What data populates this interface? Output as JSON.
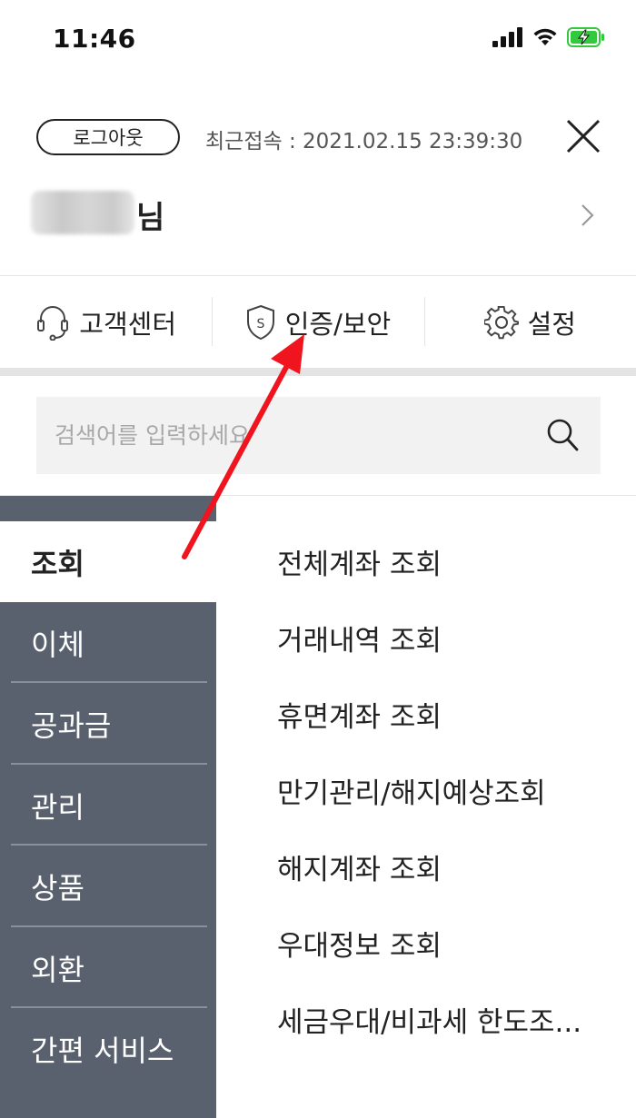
{
  "status_bar": {
    "time": "11:46",
    "icons": [
      "cellular-signal-icon",
      "wifi-icon",
      "battery-charging-icon"
    ]
  },
  "header": {
    "logout_label": "로그아웃",
    "last_login": "최근접속 : 2021.02.15 23:39:30",
    "close_icon": "close-icon",
    "user_suffix": "님",
    "user_chevron_icon": "chevron-right-icon"
  },
  "quick_menu": [
    {
      "label": "고객센터",
      "icon": "headset-icon"
    },
    {
      "label": "인증/보안",
      "icon": "shield-icon"
    },
    {
      "label": "설정",
      "icon": "gear-icon"
    }
  ],
  "search": {
    "placeholder": "검색어를 입력하세요",
    "value": "",
    "icon": "search-icon"
  },
  "categories": [
    {
      "label": "조회",
      "selected": true
    },
    {
      "label": "이체",
      "selected": false
    },
    {
      "label": "공과금",
      "selected": false
    },
    {
      "label": "관리",
      "selected": false
    },
    {
      "label": "상품",
      "selected": false
    },
    {
      "label": "외환",
      "selected": false
    },
    {
      "label": "간편 서비스",
      "selected": false
    }
  ],
  "sub_items": [
    "전체계좌 조회",
    "거래내역 조회",
    "휴면계좌 조회",
    "만기관리/해지예상조회",
    "해지계좌 조회",
    "우대정보 조회",
    "세금우대/비과세 한도조..."
  ],
  "colors": {
    "menu_bg": "#5a616e",
    "menu_separator": "#8a909a",
    "battery_green": "#32c93c",
    "annotation_arrow": "#f0141e",
    "search_bg": "#f2f2f2"
  }
}
